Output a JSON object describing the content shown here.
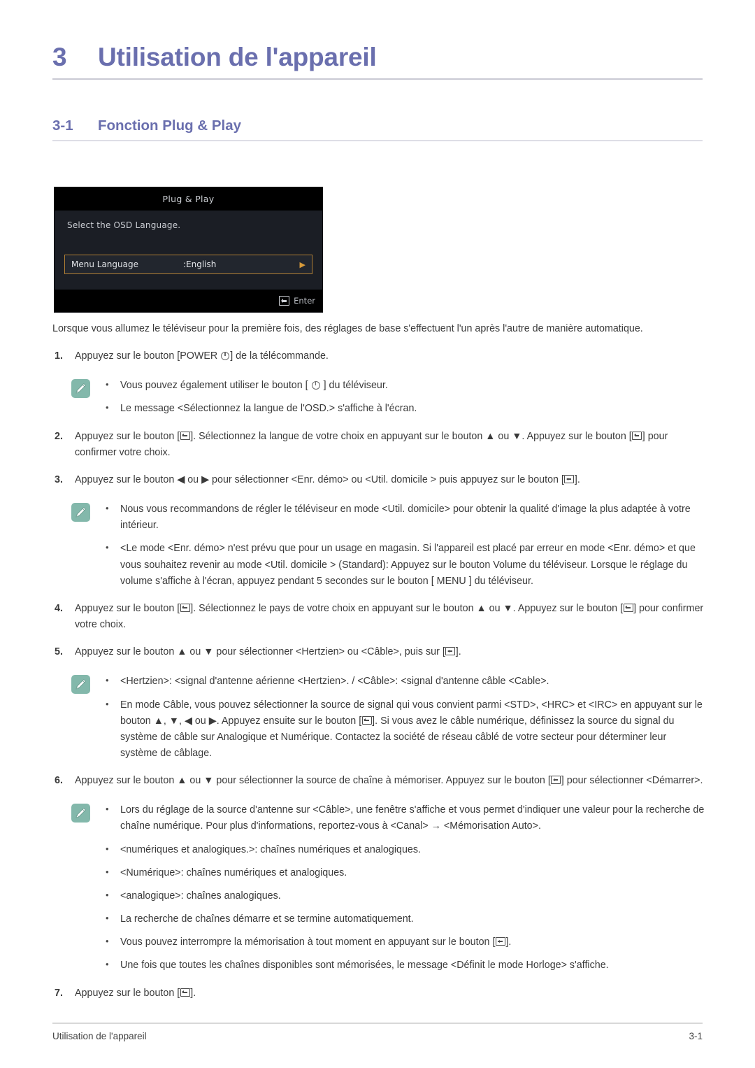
{
  "chapter": {
    "number": "3",
    "title": "Utilisation de l'appareil"
  },
  "section": {
    "number": "3-1",
    "title": "Fonction Plug & Play"
  },
  "osd": {
    "title": "Plug & Play",
    "prompt": "Select the OSD Language.",
    "item_label": "Menu Language",
    "item_value": ":English",
    "item_arrow": "▶",
    "footer_label": "Enter"
  },
  "intro": "Lorsque vous allumez le téléviseur pour la première fois, des réglages de base s'effectuent l'un après l'autre de manière automatique.",
  "steps": [
    {
      "number": "1.",
      "text_before": "Appuyez sur le bouton [POWER ",
      "key": "power-icon",
      "text_after": "] de la télécommande."
    },
    {
      "number": "2.",
      "part1": "Appuyez sur le bouton [",
      "part2": "]. Sélectionnez la langue de votre choix en appuyant sur le bouton ▲ ou ▼. Appuyez sur le bouton [",
      "part3": "] pour confirmer votre choix."
    },
    {
      "number": "3.",
      "part1": "Appuyez sur le bouton ◀ ou ▶ pour sélectionner <Enr. démo> ou <Util. domicile > puis appuyez sur le bouton [",
      "part2": "]."
    },
    {
      "number": "4.",
      "part1": "Appuyez sur le bouton [",
      "part2": "]. Sélectionnez le pays de votre choix en appuyant sur le bouton ▲ ou ▼. Appuyez sur le bouton [",
      "part3": "] pour confirmer votre choix."
    },
    {
      "number": "5.",
      "part1": "Appuyez sur le bouton ▲ ou ▼ pour sélectionner <Hertzien> ou <Câble>, puis sur [",
      "part2": "]."
    },
    {
      "number": "6.",
      "part1": "Appuyez sur le bouton ▲ ou ▼ pour sélectionner la source de chaîne à mémoriser. Appuyez sur le bouton [",
      "part2": "] pour sélectionner <Démarrer>."
    },
    {
      "number": "7.",
      "part1": "Appuyez sur le bouton [",
      "part2": "]."
    }
  ],
  "note1": {
    "icon": "note-pencil-icon",
    "items": [
      {
        "part1": "Vous pouvez également utiliser le bouton [ ",
        "part2": " ] du téléviseur."
      },
      {
        "text": "Le message <Sélectionnez la langue de l'OSD.> s'affiche à l'écran."
      }
    ]
  },
  "note2": {
    "icon": "note-pencil-icon",
    "items": [
      {
        "text": "Nous vous recommandons de régler le téléviseur en mode <Util. domicile> pour obtenir la qualité d'image la plus adaptée à votre intérieur."
      },
      {
        "text": "<Le mode <Enr. démo> n'est prévu que pour un usage en magasin. Si l'appareil est placé par erreur en mode <Enr. démo> et que vous souhaitez revenir au mode <Util. domicile > (Standard): Appuyez sur le bouton Volume du téléviseur. Lorsque le réglage du volume s'affiche à l'écran, appuyez pendant 5 secondes sur le bouton [ MENU ] du téléviseur."
      }
    ]
  },
  "note3": {
    "icon": "note-pencil-icon",
    "items": [
      {
        "text": "<Hertzien>: <signal d'antenne aérienne <Hertzien>. / <Câble>: <signal d'antenne câble <Cable>."
      },
      {
        "part1": "En mode Câble, vous pouvez sélectionner la source de signal qui vous convient parmi <STD>, <HRC> et <IRC> en appuyant sur le bouton ▲, ▼, ◀ ou ▶. Appuyez ensuite sur le bouton [",
        "part2": "]. Si vous avez le câble numérique, définissez la source du signal du système de câble sur Analogique et Numérique. Contactez la société de réseau câblé de votre secteur pour déterminer leur système de câblage."
      }
    ]
  },
  "note4": {
    "icon": "note-pencil-icon",
    "items": [
      {
        "text": "Lors du réglage de la source d'antenne sur <Câble>, une fenêtre s'affiche et vous permet d'indiquer une valeur pour la recherche de chaîne numérique. Pour plus d'informations, reportez-vous à <Canal> → <Mémorisation Auto>."
      }
    ]
  },
  "note4_extra": [
    {
      "text": "<numériques et analogiques.>: chaînes numériques et analogiques."
    },
    {
      "text": "<Numérique>: chaînes numériques et analogiques."
    },
    {
      "text": "<analogique>: chaînes analogiques."
    },
    {
      "text": "La recherche de chaînes démarre et se termine automatiquement."
    },
    {
      "part1": "Vous pouvez interrompre la mémorisation à tout moment en appuyant sur le bouton [",
      "part2": "]."
    },
    {
      "text": "Une fois que toutes les chaînes disponibles sont mémorisées, le message <Définit le mode Horloge> s'affiche."
    }
  ],
  "footer": {
    "left": "Utilisation de l'appareil",
    "right": "3-1"
  },
  "colors": {
    "heading": "#6a6fae",
    "note_icon_bg": "#83b8ab",
    "osd_highlight_border": "#b07f35",
    "osd_bg": "#1b1e25"
  }
}
